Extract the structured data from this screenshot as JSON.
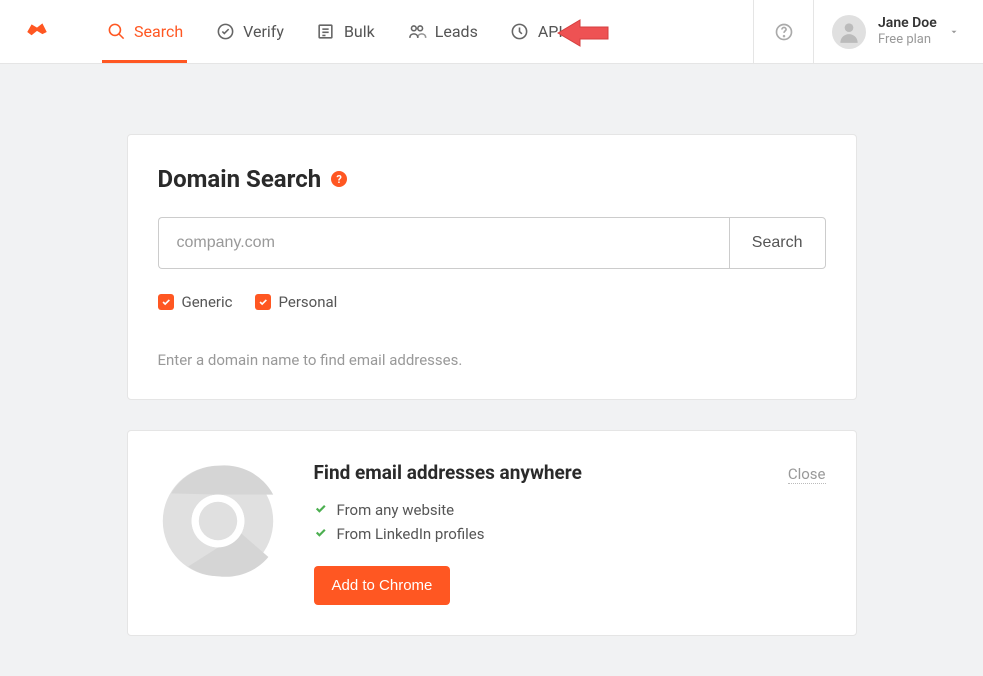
{
  "nav": {
    "items": [
      {
        "label": "Search"
      },
      {
        "label": "Verify"
      },
      {
        "label": "Bulk"
      },
      {
        "label": "Leads"
      },
      {
        "label": "API"
      }
    ]
  },
  "user": {
    "name": "Jane Doe",
    "plan": "Free plan"
  },
  "search_card": {
    "title": "Domain Search",
    "help_badge": "?",
    "input_placeholder": "company.com",
    "button_label": "Search",
    "filters": [
      {
        "label": "Generic",
        "checked": true
      },
      {
        "label": "Personal",
        "checked": true
      }
    ],
    "hint": "Enter a domain name to find email addresses."
  },
  "promo": {
    "title": "Find email addresses anywhere",
    "features": [
      "From any website",
      "From LinkedIn profiles"
    ],
    "cta": "Add to Chrome",
    "close": "Close"
  }
}
